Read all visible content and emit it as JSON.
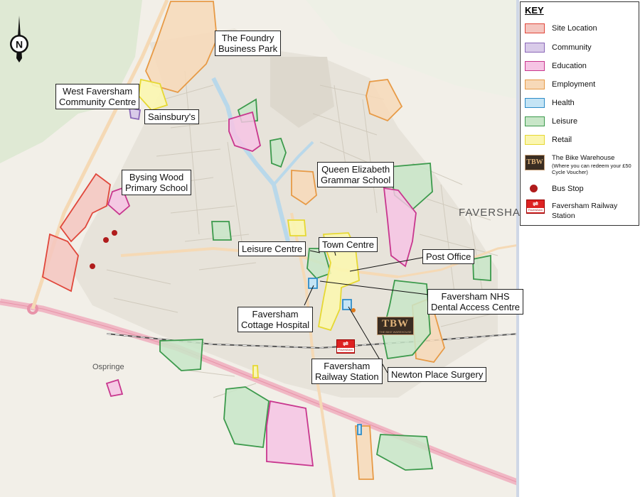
{
  "key": {
    "title": "KEY",
    "items": [
      {
        "label": "Site Location",
        "fill": "#f4c6c0",
        "stroke": "#e0463a"
      },
      {
        "label": "Community",
        "fill": "#d9cbe9",
        "stroke": "#8a67b8"
      },
      {
        "label": "Education",
        "fill": "#f6c4e4",
        "stroke": "#c8378e"
      },
      {
        "label": "Employment",
        "fill": "#f7d9b8",
        "stroke": "#e79a46"
      },
      {
        "label": "Health",
        "fill": "#c4e4f5",
        "stroke": "#2d8cc8"
      },
      {
        "label": "Leisure",
        "fill": "#c8e6c8",
        "stroke": "#3c9a4c"
      },
      {
        "label": "Retail",
        "fill": "#fbf6b0",
        "stroke": "#e6d832"
      }
    ],
    "bike_warehouse": {
      "label": "The Bike Warehouse",
      "note": "(Where you can redeem your £50 Cycle Voucher)"
    },
    "bus_stop": {
      "label": "Bus Stop",
      "color": "#b01c1c"
    },
    "railway": {
      "label": "Faversham Railway Station",
      "logo_text": "Faversham"
    }
  },
  "map": {
    "town_label": "FAVERSHAM",
    "ospringe_label": "Ospringe",
    "north_letter": "N",
    "tbw_logo": {
      "text": "TBW",
      "subtext": "THE BIKE WAREHOUSE"
    },
    "callouts": {
      "foundry": [
        "The Foundry",
        "Business Park"
      ],
      "west_faversham": [
        "West Faversham",
        "Community Centre"
      ],
      "sainsburys": "Sainsbury's",
      "bysing_wood": [
        "Bysing Wood",
        "Primary School"
      ],
      "queen_elizabeth": [
        "Queen Elizabeth",
        "Grammar School"
      ],
      "leisure_centre": "Leisure Centre",
      "town_centre": "Town Centre",
      "post_office": "Post Office",
      "nhs_dental": [
        "Faversham NHS",
        "Dental Access Centre"
      ],
      "cottage_hospital": [
        "Faversham",
        "Cottage Hospital"
      ],
      "railway_station": [
        "Faversham",
        "Railway Station"
      ],
      "newton_place": "Newton Place Surgery"
    }
  }
}
